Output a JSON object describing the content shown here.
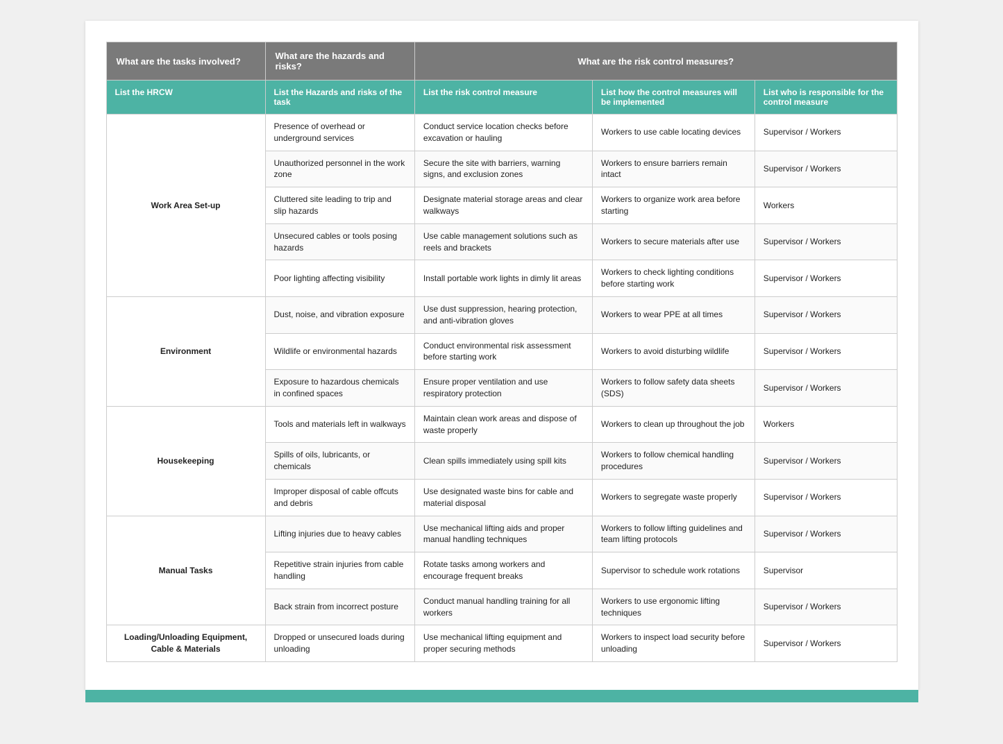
{
  "header1": {
    "col1": "What are the tasks involved?",
    "col2": "What are the hazards and risks?",
    "col3": "What are the risk control measures?"
  },
  "header2": {
    "col1": "List the HRCW",
    "col2": "List the Hazards and risks of the task",
    "col3": "List the risk control measure",
    "col4": "List how the control measures will be implemented",
    "col5": "List who is responsible for the control measure"
  },
  "rows": [
    {
      "category": "Work Area Set-up",
      "category_rowspan": 5,
      "hazard": "Presence of overhead or underground services",
      "control": "Conduct service location checks before excavation or hauling",
      "implementation": "Workers to use cable locating devices",
      "responsible": "Supervisor / Workers"
    },
    {
      "category": null,
      "hazard": "Unauthorized personnel in the work zone",
      "control": "Secure the site with barriers, warning signs, and exclusion zones",
      "implementation": "Workers to ensure barriers remain intact",
      "responsible": "Supervisor / Workers"
    },
    {
      "category": null,
      "hazard": "Cluttered site leading to trip and slip hazards",
      "control": "Designate material storage areas and clear walkways",
      "implementation": "Workers to organize work area before starting",
      "responsible": "Workers"
    },
    {
      "category": null,
      "hazard": "Unsecured cables or tools posing hazards",
      "control": "Use cable management solutions such as reels and brackets",
      "implementation": "Workers to secure materials after use",
      "responsible": "Supervisor / Workers"
    },
    {
      "category": null,
      "hazard": "Poor lighting affecting visibility",
      "control": "Install portable work lights in dimly lit areas",
      "implementation": "Workers to check lighting conditions before starting work",
      "responsible": "Supervisor / Workers"
    },
    {
      "category": "Environment",
      "category_rowspan": 3,
      "hazard": "Dust, noise, and vibration exposure",
      "control": "Use dust suppression, hearing protection, and anti-vibration gloves",
      "implementation": "Workers to wear PPE at all times",
      "responsible": "Supervisor / Workers"
    },
    {
      "category": null,
      "hazard": "Wildlife or environmental hazards",
      "control": "Conduct environmental risk assessment before starting work",
      "implementation": "Workers to avoid disturbing wildlife",
      "responsible": "Supervisor / Workers"
    },
    {
      "category": null,
      "hazard": "Exposure to hazardous chemicals in confined spaces",
      "control": "Ensure proper ventilation and use respiratory protection",
      "implementation": "Workers to follow safety data sheets (SDS)",
      "responsible": "Supervisor / Workers"
    },
    {
      "category": "Housekeeping",
      "category_rowspan": 3,
      "hazard": "Tools and materials left in walkways",
      "control": "Maintain clean work areas and dispose of waste properly",
      "implementation": "Workers to clean up throughout the job",
      "responsible": "Workers"
    },
    {
      "category": null,
      "hazard": "Spills of oils, lubricants, or chemicals",
      "control": "Clean spills immediately using spill kits",
      "implementation": "Workers to follow chemical handling procedures",
      "responsible": "Supervisor / Workers"
    },
    {
      "category": null,
      "hazard": "Improper disposal of cable offcuts and debris",
      "control": "Use designated waste bins for cable and material disposal",
      "implementation": "Workers to segregate waste properly",
      "responsible": "Supervisor / Workers"
    },
    {
      "category": "Manual Tasks",
      "category_rowspan": 3,
      "hazard": "Lifting injuries due to heavy cables",
      "control": "Use mechanical lifting aids and proper manual handling techniques",
      "implementation": "Workers to follow lifting guidelines and team lifting protocols",
      "responsible": "Supervisor / Workers"
    },
    {
      "category": null,
      "hazard": "Repetitive strain injuries from cable handling",
      "control": "Rotate tasks among workers and encourage frequent breaks",
      "implementation": "Supervisor to schedule work rotations",
      "responsible": "Supervisor"
    },
    {
      "category": null,
      "hazard": "Back strain from incorrect posture",
      "control": "Conduct manual handling training for all workers",
      "implementation": "Workers to use ergonomic lifting techniques",
      "responsible": "Supervisor / Workers"
    },
    {
      "category": "Loading/Unloading Equipment, Cable & Materials",
      "category_rowspan": 1,
      "hazard": "Dropped or unsecured loads during unloading",
      "control": "Use mechanical lifting equipment and proper securing methods",
      "implementation": "Workers to inspect load security before unloading",
      "responsible": "Supervisor / Workers"
    }
  ]
}
